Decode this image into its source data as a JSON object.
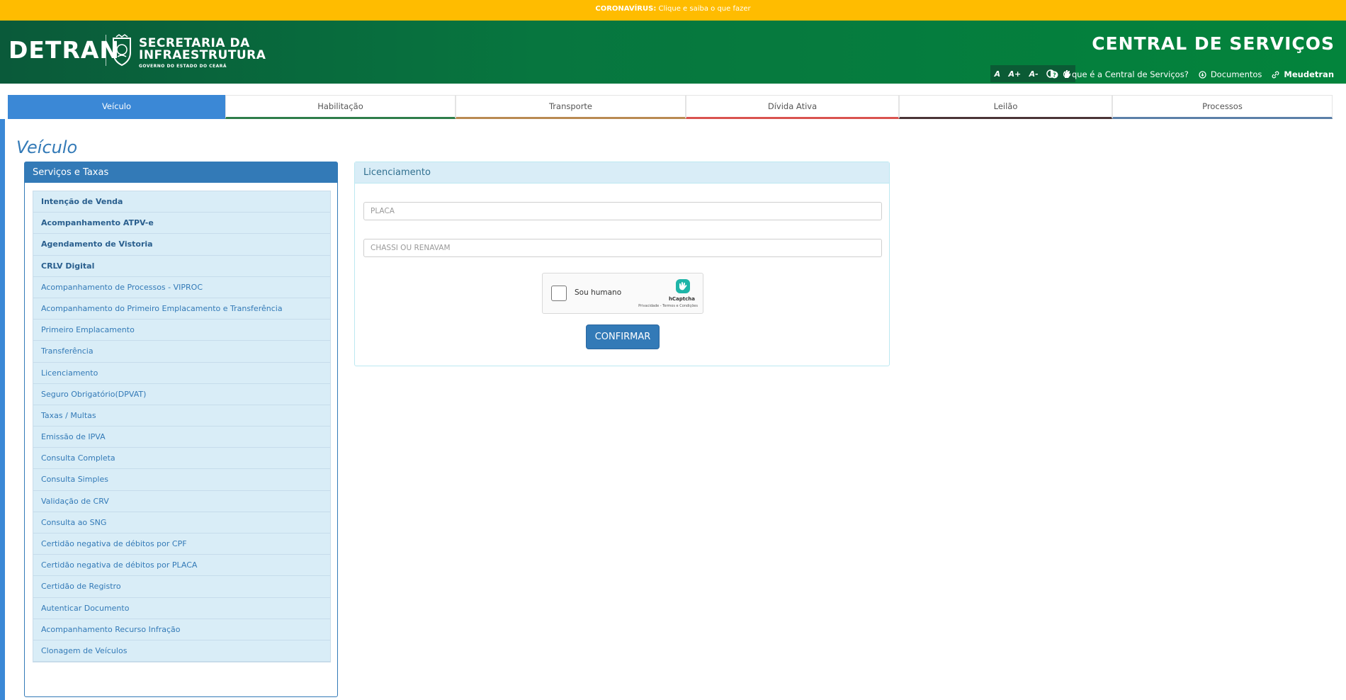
{
  "alert": {
    "bold": "CORONAVÍRUS:",
    "text": "Clique e saiba o que fazer"
  },
  "header": {
    "brand": "DETRAN",
    "secretaria_line1": "SECRETARIA DA",
    "secretaria_line2": "INFRAESTRUTURA",
    "governo": "GOVERNO DO ESTADO DO CEARÁ",
    "site_title": "CENTRAL DE SERVIÇOS",
    "a11y": [
      "A",
      "A+",
      "A-"
    ],
    "links": {
      "what": "O que é a Central de Serviços?",
      "docs": "Documentos",
      "meudetran": "Meudetran"
    }
  },
  "tabs": [
    {
      "label": "Veículo",
      "color": "#3b88d6"
    },
    {
      "label": "Habilitação",
      "color": "#2e7d4a"
    },
    {
      "label": "Transporte",
      "color": "#b98a52"
    },
    {
      "label": "Dívida Ativa",
      "color": "#d9534f"
    },
    {
      "label": "Leilão",
      "color": "#4a3436"
    },
    {
      "label": "Processos",
      "color": "#5b7fa8"
    }
  ],
  "page_title": "Veículo",
  "services": {
    "title": "Serviços e Taxas",
    "items": [
      "Intenção de Venda",
      "Acompanhamento ATPV-e",
      "Agendamento de Vistoria",
      "CRLV Digital",
      "Acompanhamento de Processos - VIPROC",
      "Acompanhamento do Primeiro Emplacamento e Transferência",
      "Primeiro Emplacamento",
      "Transferência",
      "Licenciamento",
      "Seguro Obrigatório(DPVAT)",
      "Taxas / Multas",
      "Emissão de IPVA",
      "Consulta Completa",
      "Consulta Simples",
      "Validação de CRV",
      "Consulta ao SNG",
      "Certidão negativa de débitos por CPF",
      "Certidão negativa de débitos por PLACA",
      "Certidão de Registro",
      "Autenticar Documento",
      "Acompanhamento Recurso Infração",
      "Clonagem de Veículos"
    ]
  },
  "licenciamento": {
    "title": "Licenciamento",
    "placa_placeholder": "PLACA",
    "chassi_placeholder": "CHASSI OU RENAVAM",
    "captcha_label": "Sou humano",
    "captcha_brand": "hCaptcha",
    "captcha_terms": "Privacidade - Termos e Condições",
    "confirm": "CONFIRMAR"
  }
}
